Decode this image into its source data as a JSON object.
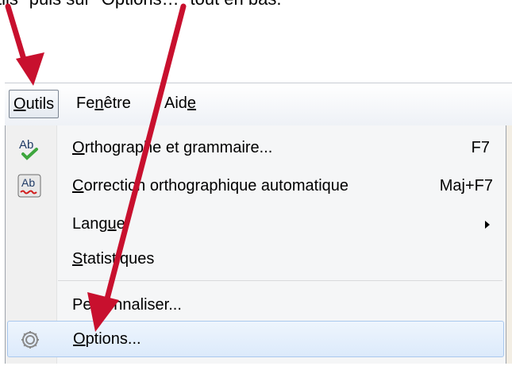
{
  "caption": "tils\" puis sur \"Options…\" tout en bas.",
  "menubar": {
    "items": [
      {
        "label_first": "O",
        "label_rest": "utils"
      },
      {
        "label_pre": "Fe",
        "label_u": "n",
        "label_post": "être"
      },
      {
        "label_pre": "Aid",
        "label_u": "e",
        "label_post": ""
      }
    ]
  },
  "menu": {
    "items": [
      {
        "pre": "",
        "u": "O",
        "post": "rthographe et grammaire...",
        "shortcut": "F7",
        "icon": "spellcheck-icon"
      },
      {
        "pre": "",
        "u": "C",
        "post": "orrection orthographique automatique",
        "shortcut": "Maj+F7",
        "icon": "autospell-icon"
      },
      {
        "pre": "Lang",
        "u": "u",
        "post": "e",
        "shortcut": "",
        "icon": ""
      },
      {
        "pre": "",
        "u": "S",
        "post": "tatistiques",
        "shortcut": "",
        "icon": ""
      },
      {
        "pre": "Pe",
        "u": "r",
        "post": "sonnaliser...",
        "shortcut": "",
        "icon": ""
      },
      {
        "pre": "",
        "u": "O",
        "post": "ptions...",
        "shortcut": "",
        "icon": "gear-icon"
      }
    ]
  },
  "colors": {
    "arrow": "#c8102e",
    "highlight_border": "#a9c8ee"
  }
}
